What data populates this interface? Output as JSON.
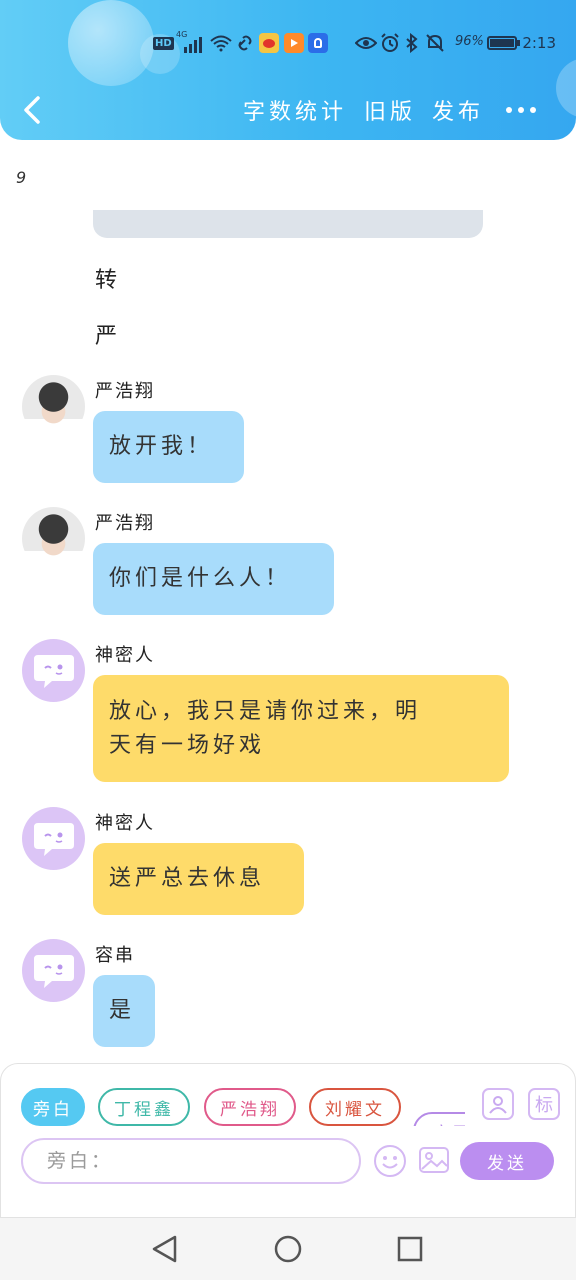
{
  "statusbar": {
    "hd_badge": "HD",
    "network": "4G",
    "battery_percent": "96%",
    "time": "2:13"
  },
  "toolbar": {
    "word_count": "字数统计",
    "old_version": "旧版",
    "publish": "发布"
  },
  "chat": {
    "page_number": "9",
    "narrations": [
      "转",
      "严"
    ],
    "messages": [
      {
        "sender": "严浩翔",
        "text": "放开我！",
        "avatar": "photo-avatar",
        "color": "#a8dcfb"
      },
      {
        "sender": "严浩翔",
        "text": "你们是什么人！",
        "avatar": "photo-avatar",
        "color": "#a8dcfb"
      },
      {
        "sender": "神密人",
        "text_line1": "放心，我只是请你过来，明",
        "text_line2": "天有一场好戏",
        "avatar": "chat-bubble-icon",
        "color": "#fedb6a"
      },
      {
        "sender": "神密人",
        "text": "送严总去休息",
        "avatar": "chat-bubble-icon",
        "color": "#fedb6a"
      },
      {
        "sender": "容串",
        "text": "是",
        "avatar": "chat-bubble-icon",
        "color": "#a8dcfb"
      }
    ]
  },
  "composer": {
    "roles": [
      {
        "label": "旁白",
        "color": "#55c9f2"
      },
      {
        "label": "丁程鑫",
        "color": "#3fb8a8"
      },
      {
        "label": "严浩翔",
        "color": "#e05a8a"
      },
      {
        "label": "刘耀文",
        "color": "#d9553f"
      },
      {
        "label": "宋亚",
        "color": "#b58ae6"
      }
    ],
    "label_button": "标",
    "input_placeholder": "旁白：",
    "send_label": "发送"
  }
}
